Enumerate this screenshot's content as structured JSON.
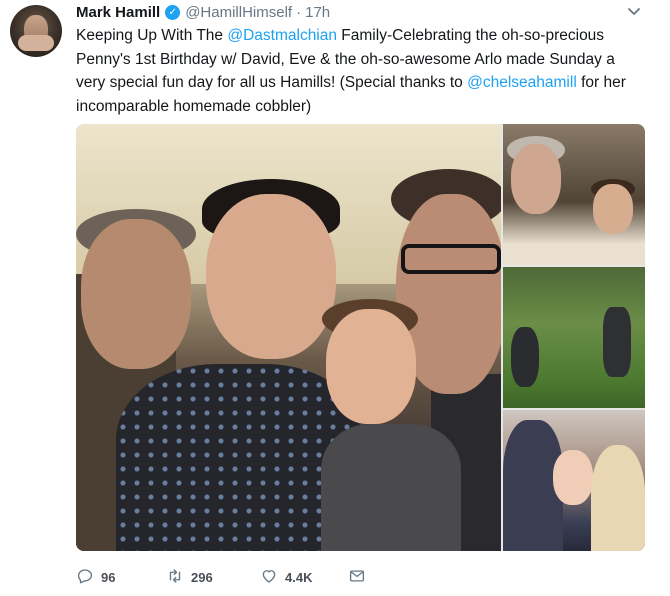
{
  "tweet": {
    "author_name": "Mark Hamill",
    "verified_icon": "verified-badge-icon",
    "handle": "@HamillHimself",
    "separator": "·",
    "time": "17h",
    "text": {
      "line1_prefix": "Keeping Up With The ",
      "line1_mention": "@Dastmalchian",
      "line1_suffix": " Family-Celebrating the oh-so-precious",
      "line2": "Penny's 1st Birthday w/ David, Eve & the oh-so-awesome Arlo made Sunday a",
      "line3_prefix": "very special fun day for all us Hamills! (Special thanks to ",
      "line3_mention": "@chelseahamill",
      "line3_suffix": " for her",
      "line4": "incomparable homemade cobbler)"
    },
    "accent_color": "#1da1f2"
  },
  "actions": {
    "reply_count": "96",
    "retweet_count": "296",
    "like_count": "4.4K"
  },
  "icons": [
    "verified-badge-icon",
    "chevron-down-icon",
    "reply-icon",
    "retweet-icon",
    "like-icon",
    "direct-message-icon"
  ]
}
